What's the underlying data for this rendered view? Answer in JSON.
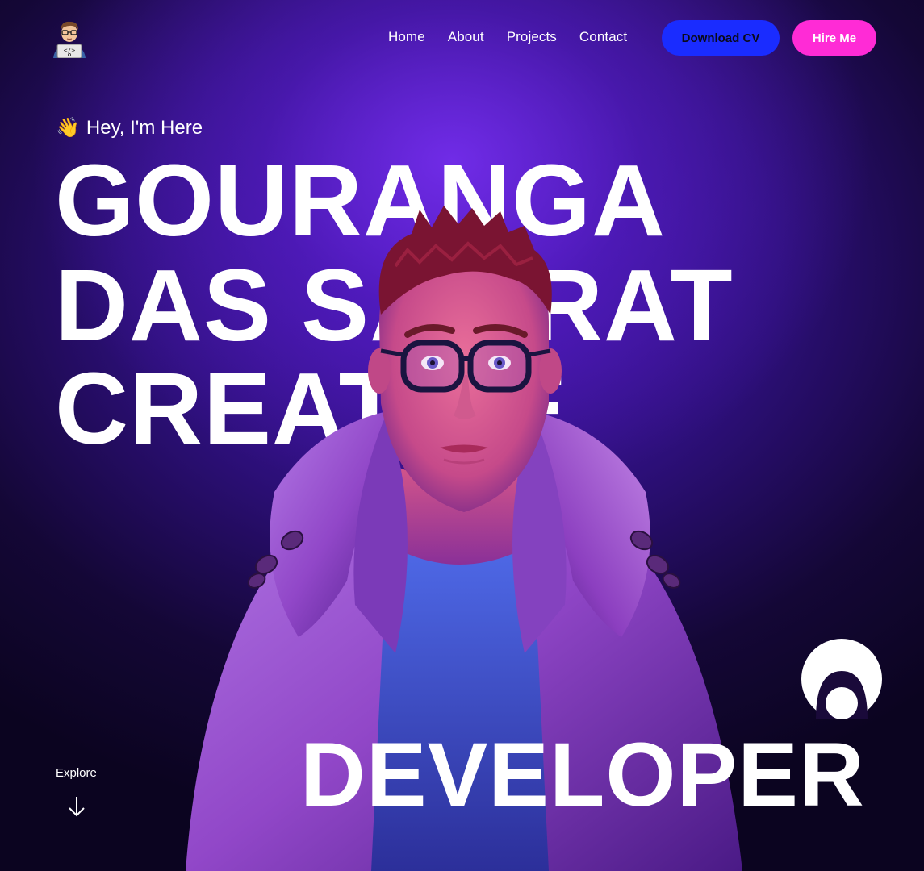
{
  "nav": {
    "links": [
      {
        "label": "Home"
      },
      {
        "label": "About"
      },
      {
        "label": "Projects"
      },
      {
        "label": "Contact"
      }
    ],
    "download_cv": "Download CV",
    "hire_me": "Hire Me"
  },
  "hero": {
    "wave_emoji": "👋",
    "greeting": "Hey, I'm Here",
    "line1": "GOURANGA",
    "line2": "DAS SAMRAT",
    "line3": "CREATIVE",
    "role": "DEVELOPER"
  },
  "explore": {
    "label": "Explore",
    "icon": "arrow-down-icon"
  },
  "colors": {
    "download_cv_bg": "#1a2cff",
    "hire_me_bg": "#ff2bd6",
    "bg_center": "#6a28e0",
    "bg_edge": "#0b0420"
  }
}
